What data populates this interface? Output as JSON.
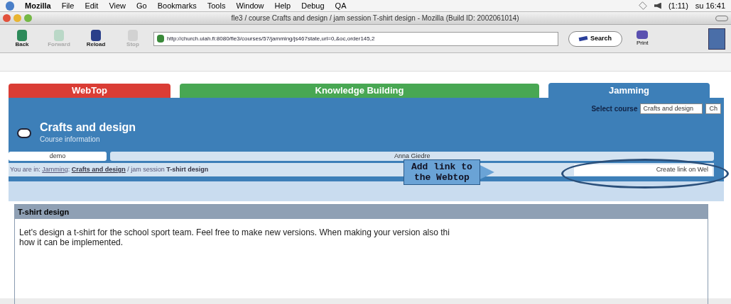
{
  "menu_bar": {
    "items": [
      "Mozilla",
      "File",
      "Edit",
      "View",
      "Go",
      "Bookmarks",
      "Tools",
      "Window",
      "Help",
      "Debug",
      "QA"
    ],
    "battery": "(1:11)",
    "clock": "su 16:41"
  },
  "window": {
    "title": "fle3 / course Crafts and design / jam session T-shirt design - Mozilla (Build ID: 2002061014)"
  },
  "toolbar": {
    "buttons": [
      {
        "label": "Back",
        "disabled": false
      },
      {
        "label": "Forward",
        "disabled": true
      },
      {
        "label": "Reload",
        "disabled": false
      },
      {
        "label": "Stop",
        "disabled": true
      }
    ],
    "url": "http://church.uiah.fi:8080/fle3/courses/57/jamming/js467state,url=0,&oc,order145,2",
    "search": "Search",
    "print": "Print"
  },
  "tabs": [
    {
      "label": "WebTop",
      "color": "#d9332b",
      "selected": false
    },
    {
      "label": "Knowledge Building",
      "color": "#3fa34a",
      "selected": false
    },
    {
      "label": "Jamming",
      "color": "#3d7fb8",
      "selected": true
    }
  ],
  "course_select": {
    "label": "Select course",
    "value": "Crafts and design",
    "button": "Ch"
  },
  "course": {
    "title": "Crafts and design",
    "subtitle": "Course information"
  },
  "user_bar": {
    "user": "demo",
    "name": "Anna Giedre"
  },
  "breadcrumb": {
    "prefix": "You are in: ",
    "link": "Jamming",
    "sep": ": ",
    "course": "Crafts and design",
    "middle": " / jam session ",
    "current": "T-shirt design"
  },
  "create_link_button": "Create link on Wel",
  "callout": {
    "lines": [
      "Add link to",
      "the Webtop"
    ]
  },
  "session": {
    "heading": "T-shirt design",
    "lines": [
      "Let's design a t-shirt for the school sport team. Feel free to make new versions. When making your version also thi",
      "how it can be implemented."
    ]
  }
}
